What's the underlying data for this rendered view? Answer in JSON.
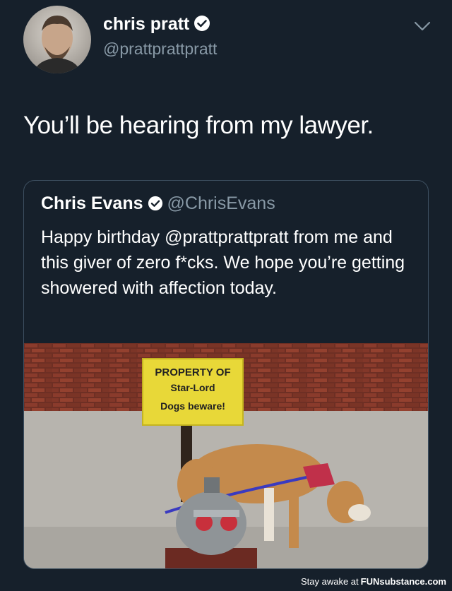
{
  "author": {
    "display_name": "chris pratt",
    "handle": "@prattprattpratt"
  },
  "tweet": {
    "text": "You’ll be hearing from my lawyer."
  },
  "quoted_tweet": {
    "display_name": "Chris Evans",
    "handle": "@ChrisEvans",
    "text": "Happy birthday @prattprattpratt from me and this giver of zero f*cks. We hope you’re getting showered with affection today."
  },
  "photo_sign": {
    "line1": "PROPERTY OF",
    "line2": "Star-Lord",
    "line3": "Dogs beware!"
  },
  "footer": {
    "prefix": "Stay awake at",
    "brand": "FUNsubstance.com"
  },
  "colors": {
    "background": "#16202b",
    "secondary_text": "#8899a6",
    "verified_blue": "#ffffff"
  }
}
